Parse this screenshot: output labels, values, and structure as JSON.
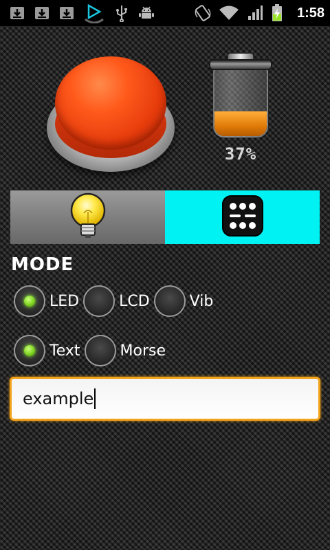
{
  "status_bar": {
    "time": "1:58",
    "icons": [
      "download-icon",
      "download-icon",
      "download-icon",
      "play-store-icon",
      "usb-icon",
      "android-debug-icon",
      "auto-rotate-icon",
      "wifi-icon",
      "signal-icon",
      "battery-charging-icon"
    ]
  },
  "battery": {
    "percent_label": "37%",
    "level": 0.37,
    "fill_color": "#e07a08"
  },
  "toggle": {
    "left_icon": "light-bulb-icon",
    "right_icon": "dice-icon",
    "right_color": "#00f2f2"
  },
  "mode": {
    "title": "MODE",
    "output_options": [
      {
        "label": "LED",
        "selected": true
      },
      {
        "label": "LCD",
        "selected": false
      },
      {
        "label": "Vib",
        "selected": false
      }
    ],
    "input_options": [
      {
        "label": "Text",
        "selected": true
      },
      {
        "label": "Morse",
        "selected": false
      }
    ]
  },
  "message_input": {
    "value": "example",
    "border_color": "#f2a31a"
  }
}
